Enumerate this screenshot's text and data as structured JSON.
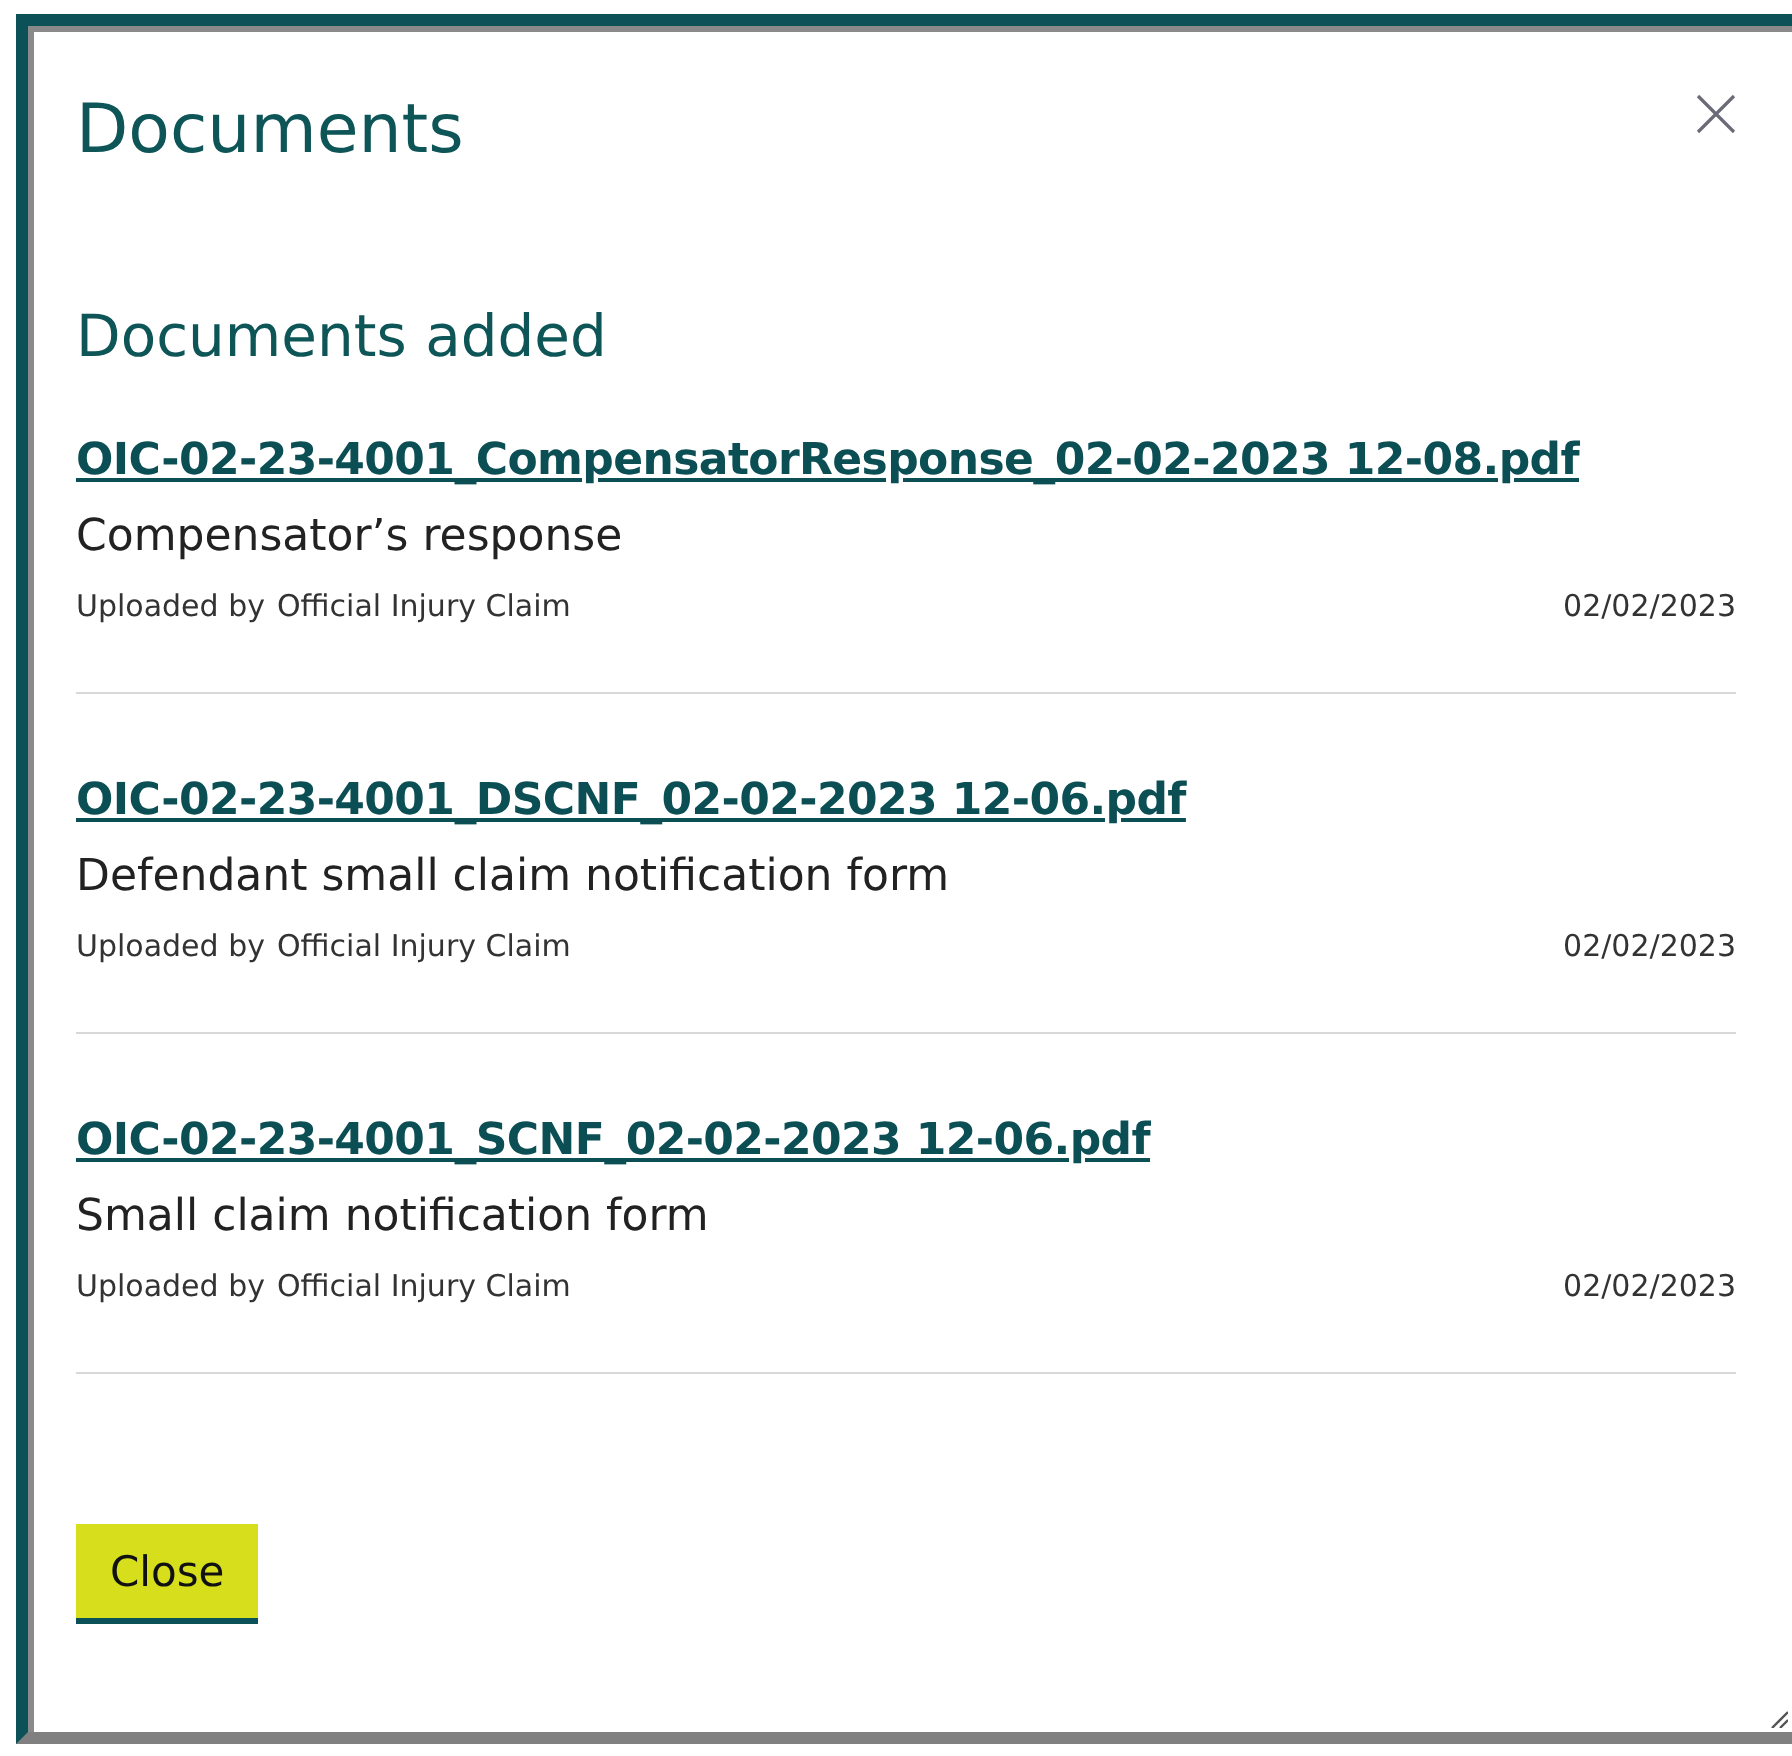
{
  "dialog": {
    "title": "Documents"
  },
  "section_title": "Documents added",
  "documents": [
    {
      "file": "OIC-02-23-4001_CompensatorResponse_02-02-2023 12-08.pdf",
      "description": "Compensator’s response",
      "uploaded_label": "Uploaded by",
      "uploader": "Official Injury Claim",
      "date": "02/02/2023"
    },
    {
      "file": "OIC-02-23-4001_DSCNF_02-02-2023 12-06.pdf",
      "description": "Defendant small claim notification form",
      "uploaded_label": "Uploaded by",
      "uploader": "Official Injury Claim",
      "date": "02/02/2023"
    },
    {
      "file": "OIC-02-23-4001_SCNF_02-02-2023 12-06.pdf",
      "description": "Small claim notification form",
      "uploaded_label": "Uploaded by",
      "uploader": "Official Injury Claim",
      "date": "02/02/2023"
    }
  ],
  "buttons": [
    "Close"
  ]
}
